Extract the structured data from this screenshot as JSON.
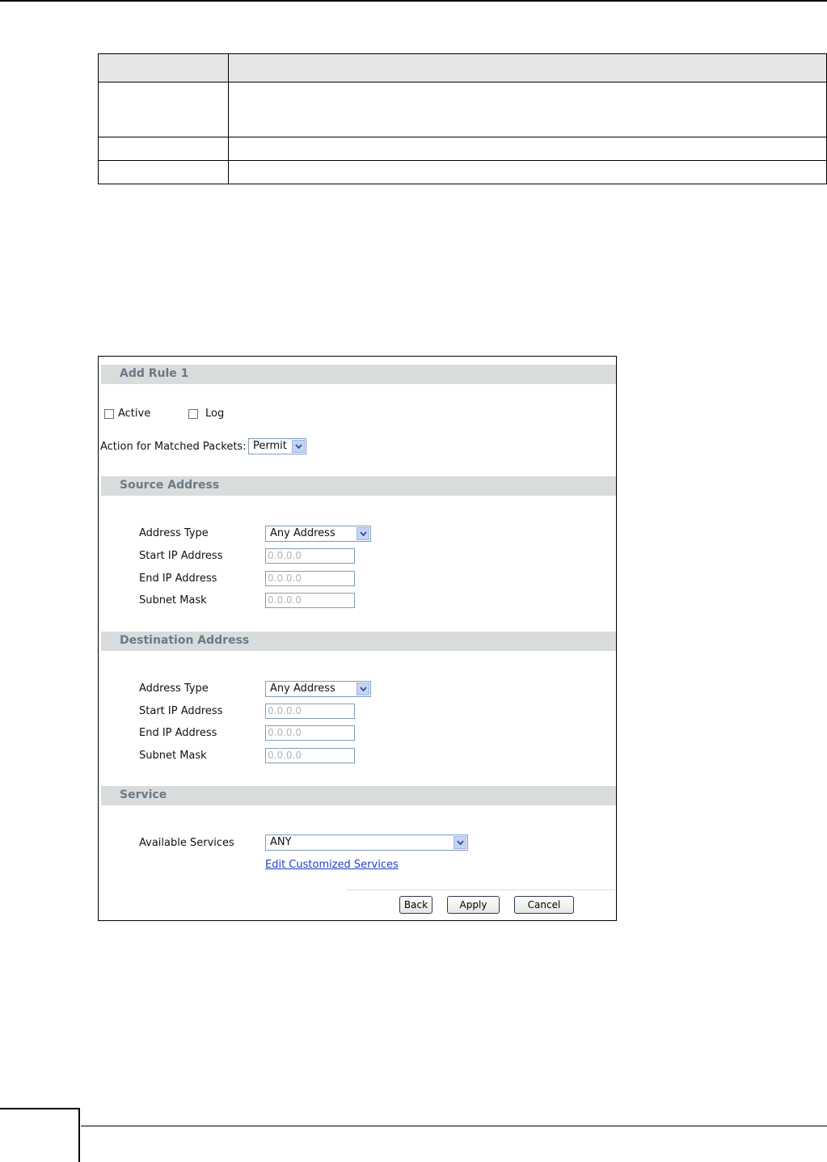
{
  "rule_screen": {
    "title": "Add Rule 1",
    "active_label": "Active",
    "log_label": "Log",
    "action_label": "Action for Matched Packets:",
    "action_value": "Permit",
    "source": {
      "header": "Source Address",
      "address_type_label": "Address Type",
      "address_type_value": "Any Address",
      "start_ip_label": "Start IP Address",
      "start_ip_value": "0.0.0.0",
      "end_ip_label": "End IP Address",
      "end_ip_value": "0.0.0.0",
      "subnet_label": "Subnet Mask",
      "subnet_value": "0.0.0.0"
    },
    "destination": {
      "header": "Destination Address",
      "address_type_label": "Address Type",
      "address_type_value": "Any Address",
      "start_ip_label": "Start IP Address",
      "start_ip_value": "0.0.0.0",
      "end_ip_label": "End IP Address",
      "end_ip_value": "0.0.0.0",
      "subnet_label": "Subnet Mask",
      "subnet_value": "0.0.0.0"
    },
    "service": {
      "header": "Service",
      "available_label": "Available Services",
      "available_value": "ANY",
      "edit_link": "Edit Customized Services"
    },
    "buttons": {
      "back": "Back",
      "apply": "Apply",
      "cancel": "Cancel"
    }
  },
  "icons": {
    "dropdown_arrow": "chevron-down-icon"
  },
  "colors": {
    "section_band": "#d9dcdc",
    "section_title": "#6a7a86",
    "link": "#1f3fc8",
    "placeholder_text": "#b5b5b5"
  }
}
